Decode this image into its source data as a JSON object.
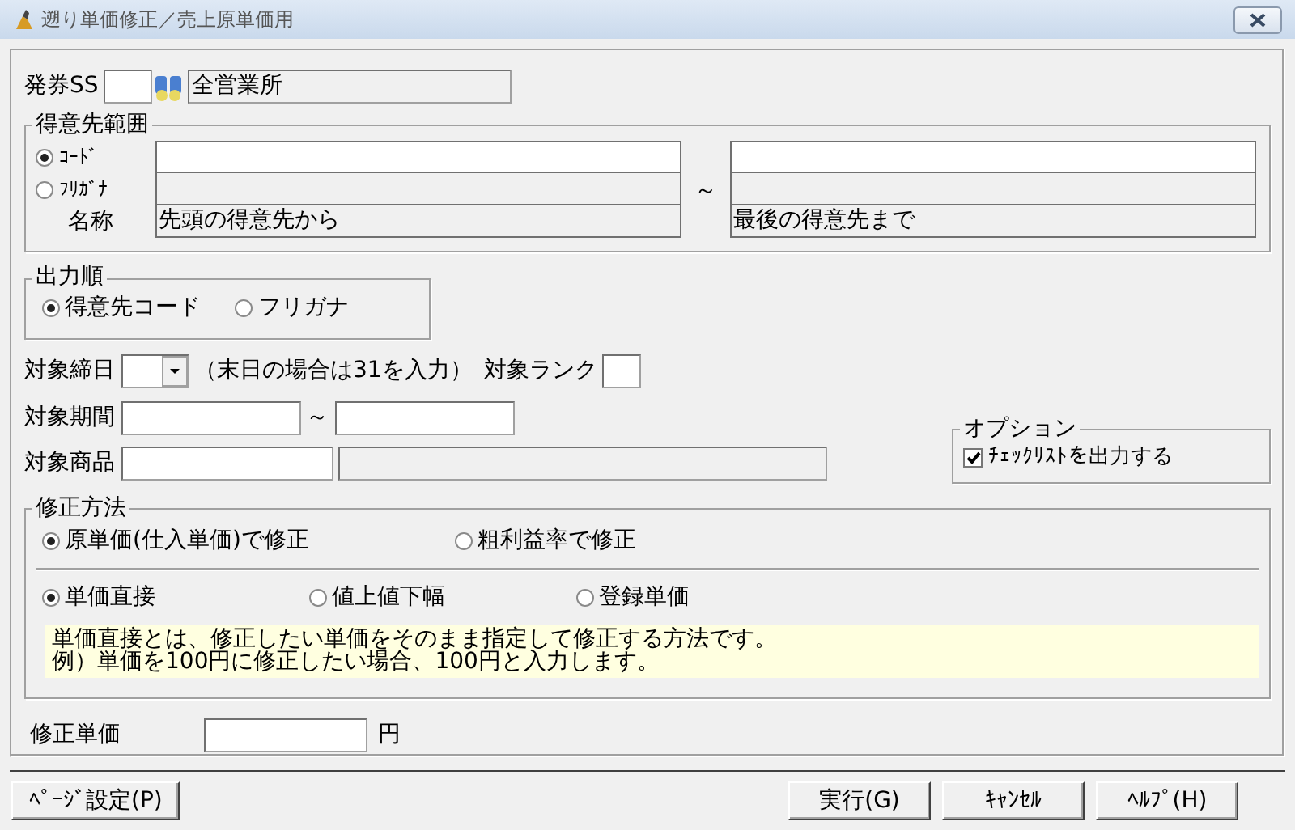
{
  "window": {
    "title": "遡り単価修正／売上原単価用"
  },
  "issuing_ss": {
    "label": "発券SS",
    "display": "全営業所"
  },
  "customer_range": {
    "title": "得意先範囲",
    "modes": [
      {
        "label": "ｺｰﾄﾞ",
        "selected": true
      },
      {
        "label": "ﾌﾘｶﾞﾅ",
        "selected": false
      }
    ],
    "name_label": "名称",
    "separator": "～",
    "from_name": "先頭の得意先から",
    "to_name": "最後の得意先まで"
  },
  "output_order": {
    "title": "出力順",
    "options": [
      {
        "label": "得意先コード",
        "selected": true
      },
      {
        "label": "フリガナ",
        "selected": false
      }
    ]
  },
  "closing_day": {
    "label": "対象締日",
    "note": "（末日の場合は31を入力）"
  },
  "rank": {
    "label": "対象ランク"
  },
  "period": {
    "label": "対象期間",
    "separator": "～"
  },
  "product": {
    "label": "対象商品"
  },
  "options": {
    "title": "オプション",
    "items": [
      {
        "label": "ﾁｪｯｸﾘｽﾄを出力する",
        "checked": true
      }
    ]
  },
  "method": {
    "title": "修正方法",
    "bases": [
      {
        "label": "原単価(仕入単価)で修正",
        "selected": true
      },
      {
        "label": "粗利益率で修正",
        "selected": false
      }
    ],
    "types": [
      {
        "label": "単価直接",
        "selected": true
      },
      {
        "label": "値上値下幅",
        "selected": false
      },
      {
        "label": "登録単価",
        "selected": false
      }
    ],
    "description": [
      "単価直接とは、修正したい単価をそのまま指定して修正する方法です。",
      "例）単価を100円に修正したい場合、100円と入力します。"
    ]
  },
  "unit_price": {
    "label": "修正単価",
    "unit": "円"
  },
  "left_buttons": [
    {
      "label": "ﾍﾟｰｼﾞ設定(P)"
    }
  ],
  "right_buttons": [
    {
      "label": "実行(G)"
    },
    {
      "label": "ｷｬﾝｾﾙ"
    },
    {
      "label": "ﾍﾙﾌﾟ(H)"
    }
  ]
}
